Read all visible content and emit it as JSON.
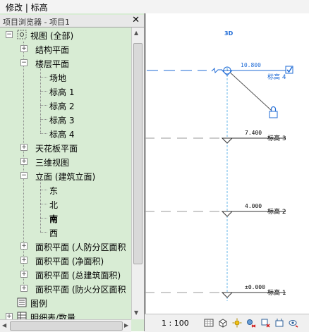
{
  "breadcrumb": "修改 | 标高",
  "browser": {
    "title": "项目浏览器 - 项目1",
    "close_glyph": "✕",
    "tree": [
      {
        "label": "视图 (全部)",
        "level": 0,
        "toggle": "−",
        "icon": "views-icon"
      },
      {
        "label": "结构平面",
        "level": 1,
        "toggle": "+"
      },
      {
        "label": "楼层平面",
        "level": 1,
        "toggle": "−"
      },
      {
        "label": "场地",
        "level": 2
      },
      {
        "label": "标高 1",
        "level": 2
      },
      {
        "label": "标高 2",
        "level": 2
      },
      {
        "label": "标高 3",
        "level": 2
      },
      {
        "label": "标高 4",
        "level": 2
      },
      {
        "label": "天花板平面",
        "level": 1,
        "toggle": "+"
      },
      {
        "label": "三维视图",
        "level": 1,
        "toggle": "+"
      },
      {
        "label": "立面 (建筑立面)",
        "level": 1,
        "toggle": "−"
      },
      {
        "label": "东",
        "level": 2
      },
      {
        "label": "北",
        "level": 2
      },
      {
        "label": "南",
        "level": 2,
        "bold": true
      },
      {
        "label": "西",
        "level": 2
      },
      {
        "label": "面积平面 (人防分区面积",
        "level": 1,
        "toggle": "+"
      },
      {
        "label": "面积平面 (净面积)",
        "level": 1,
        "toggle": "+"
      },
      {
        "label": "面积平面 (总建筑面积)",
        "level": 1,
        "toggle": "+"
      },
      {
        "label": "面积平面 (防火分区面积",
        "level": 1,
        "toggle": "+"
      },
      {
        "label": "图例",
        "level": 0,
        "toggle": "",
        "icon": "legend-icon"
      },
      {
        "label": "明细表/数量",
        "level": 0,
        "toggle": "+",
        "icon": "schedule-icon"
      }
    ]
  },
  "view": {
    "label_3d": "3D",
    "levels": [
      {
        "elev": "10.800",
        "name": "标高 4"
      },
      {
        "elev": "7.400",
        "name": "标高 3"
      },
      {
        "elev": "4.000",
        "name": "标高 2"
      },
      {
        "elev": "±0.000",
        "name": "标高 1"
      }
    ]
  },
  "statusbar": {
    "scale": "1 : 100"
  },
  "colors": {
    "accent": "#1f6bd6",
    "panel": "#d8ecd4",
    "level_line": "#1f6bd6"
  }
}
